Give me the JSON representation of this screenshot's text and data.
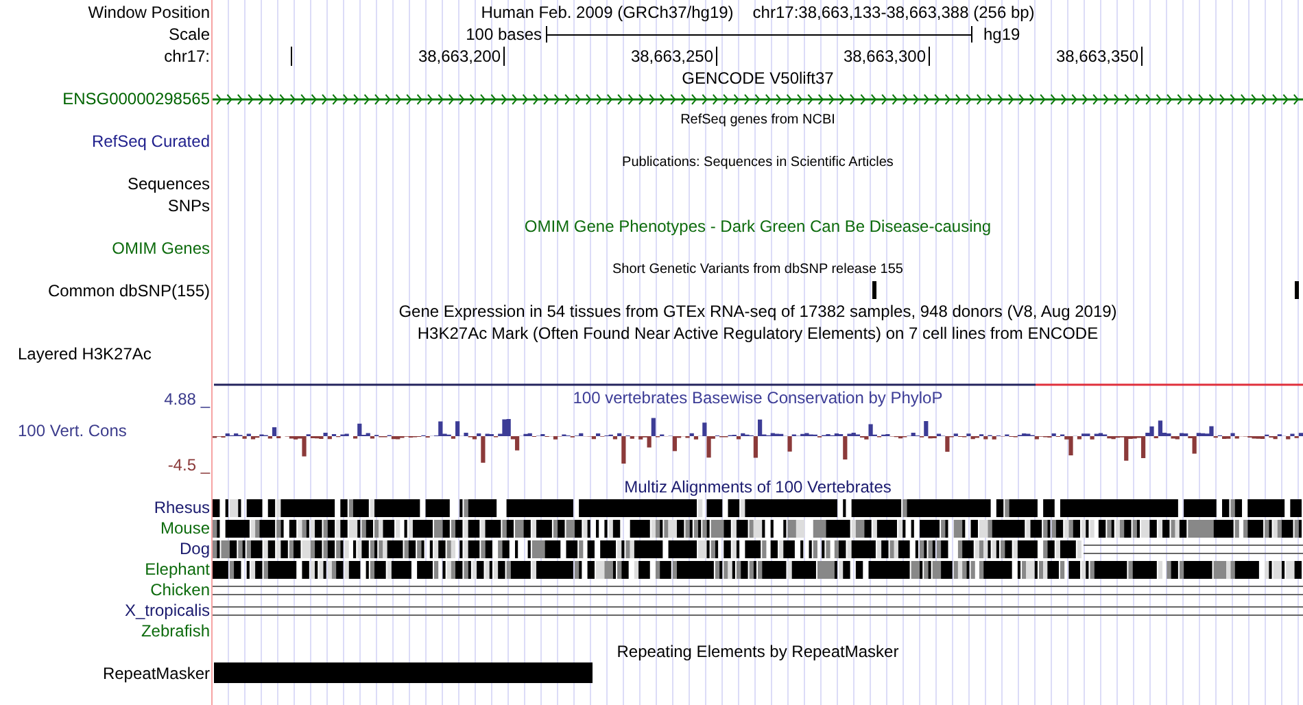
{
  "header": {
    "label": "Window Position",
    "assembly": "Human Feb. 2009 (GRCh37/hg19)",
    "position": "chr17:38,663,133-38,663,388 (256 bp)"
  },
  "scale": {
    "label": "Scale",
    "length": "100 bases",
    "assembly": "hg19"
  },
  "ruler": {
    "label": "chr17:",
    "ticks": [
      "38,663,200",
      "38,663,250",
      "38,663,300",
      "38,663,350"
    ]
  },
  "tracks": [
    {
      "kind": "title",
      "text": "GENCODE V50lift37"
    },
    {
      "kind": "gene",
      "label": "ENSG00000298565",
      "color": "#006400"
    },
    {
      "kind": "subtitle",
      "text": "RefSeq genes from NCBI"
    },
    {
      "kind": "empty",
      "label": "RefSeq Curated",
      "color": "#1f1f8c"
    },
    {
      "kind": "subtitle",
      "text": "Publications: Sequences in Scientific Articles"
    },
    {
      "kind": "empty",
      "label": "Sequences"
    },
    {
      "kind": "empty",
      "label": "SNPs"
    },
    {
      "kind": "title",
      "text": "OMIM Gene Phenotypes - Dark Green Can Be Disease-causing",
      "color": "#0d6b0d"
    },
    {
      "kind": "empty",
      "label": "OMIM Genes",
      "color": "#0d6b0d"
    },
    {
      "kind": "subtitle",
      "text": "Short Genetic Variants from dbSNP release 155"
    },
    {
      "kind": "snp",
      "label": "Common dbSNP(155)"
    },
    {
      "kind": "title",
      "text": "Gene Expression in 54 tissues from GTEx RNA-seq of 17382 samples, 948 donors (V8, Aug 2019)"
    },
    {
      "kind": "title",
      "text": "H3K27Ac Mark (Often Found Near Active Regulatory Elements) on 7 cell lines from ENCODE"
    },
    {
      "kind": "layered",
      "label": "Layered H3K27Ac"
    },
    {
      "kind": "line"
    },
    {
      "kind": "wiggle",
      "title": "100 vertebrates Basewise Conservation by PhyloP",
      "label": "100 Vert. Cons",
      "max": "4.88 _",
      "min": "-4.5 _",
      "color": "#3c3c8c"
    },
    {
      "kind": "title",
      "text": "Multiz Alignments of 100 Vertebrates",
      "color": "#1a1a6e"
    },
    {
      "kind": "alignment",
      "label": "Rhesus",
      "color": "#1a1a6e"
    },
    {
      "kind": "alignment",
      "label": "Mouse",
      "color": "#0d6b0d"
    },
    {
      "kind": "partial",
      "label": "Dog",
      "color": "#1a1a6e"
    },
    {
      "kind": "alignment",
      "label": "Elephant",
      "color": "#0d6b0d"
    },
    {
      "kind": "double-line",
      "label": "Chicken",
      "color": "#0d6b0d"
    },
    {
      "kind": "double-line",
      "label": "X_tropicalis",
      "color": "#1a1a6e"
    },
    {
      "kind": "none",
      "label": "Zebrafish",
      "color": "#0d6b0d"
    },
    {
      "kind": "title",
      "text": "Repeating Elements by RepeatMasker"
    },
    {
      "kind": "bar",
      "label": "RepeatMasker"
    }
  ]
}
